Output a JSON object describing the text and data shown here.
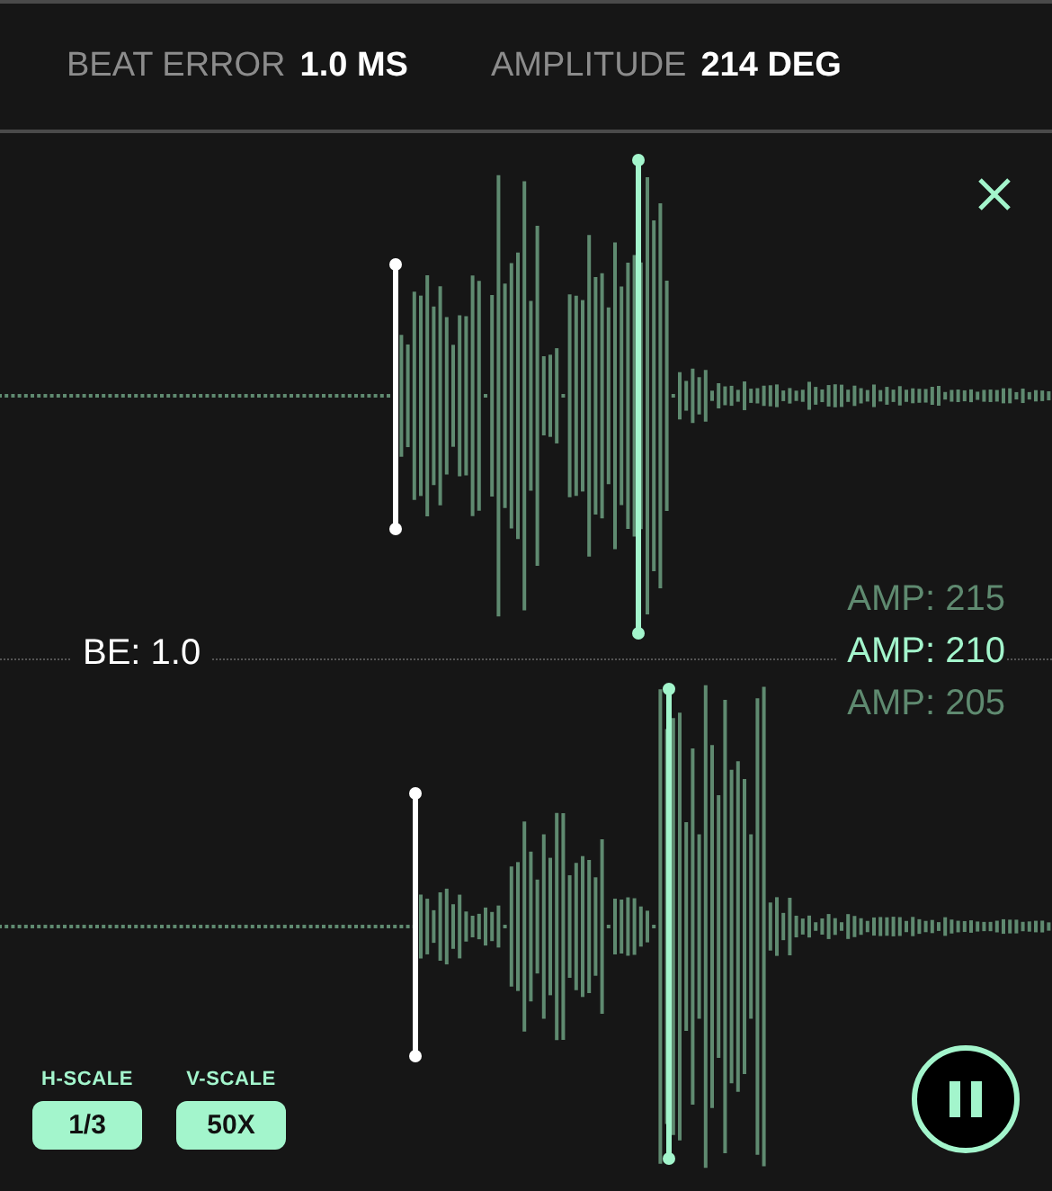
{
  "header": {
    "metrics": [
      {
        "label": "BEAT ERROR",
        "value": "1.0 MS"
      },
      {
        "label": "AMPLITUDE",
        "value": "214 DEG"
      }
    ]
  },
  "beat_error_label": "BE: 1.0",
  "amplitude_options": [
    {
      "label": "AMP: 215",
      "selected": false
    },
    {
      "label": "AMP: 210",
      "selected": true
    },
    {
      "label": "AMP: 205",
      "selected": false
    }
  ],
  "scales": [
    {
      "label": "H-SCALE",
      "value": "1/3"
    },
    {
      "label": "V-SCALE",
      "value": "50X"
    }
  ]
}
